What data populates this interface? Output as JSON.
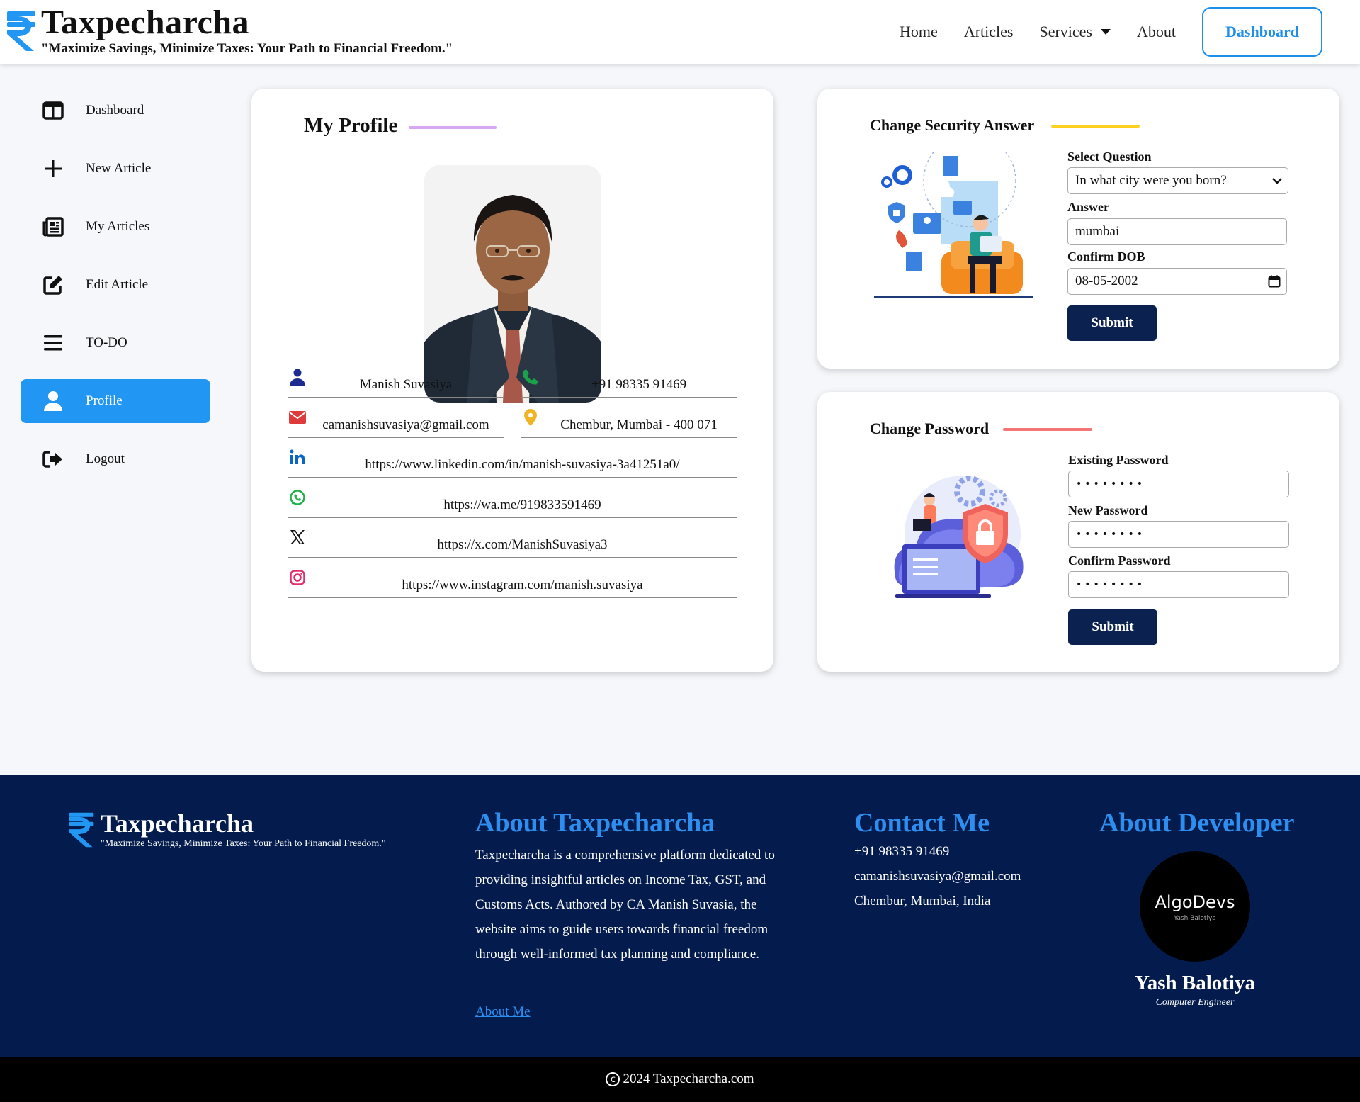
{
  "brand": {
    "name": "Taxpecharcha",
    "tagline": "\"Maximize Savings, Minimize Taxes: Your Path to Financial Freedom.\""
  },
  "nav": {
    "home": "Home",
    "articles": "Articles",
    "services": "Services",
    "about": "About",
    "dashboard": "Dashboard"
  },
  "sidebar": {
    "items": [
      {
        "label": "Dashboard",
        "icon": "dashboard-icon"
      },
      {
        "label": "New Article",
        "icon": "plus-icon"
      },
      {
        "label": "My Articles",
        "icon": "newspaper-icon"
      },
      {
        "label": "Edit Article",
        "icon": "edit-icon"
      },
      {
        "label": "TO-DO",
        "icon": "list-icon"
      },
      {
        "label": "Profile",
        "icon": "user-icon"
      },
      {
        "label": "Logout",
        "icon": "logout-icon"
      }
    ],
    "active_index": 5,
    "active_color": "#2196f3"
  },
  "profile": {
    "title": "My Profile",
    "name": "Manish Suvasiya",
    "phone": "+91 98335 91469",
    "email": "camanishsuvasiya@gmail.com",
    "location": "Chembur, Mumbai - 400 071",
    "linkedin": "https://www.linkedin.com/in/manish-suvasiya-3a41251a0/",
    "whatsapp": "https://wa.me/919833591469",
    "x": "https://x.com/ManishSuvasiya3",
    "instagram": "https://www.instagram.com/manish.suvasiya"
  },
  "security": {
    "title": "Change Security Answer",
    "question_label": "Select Question",
    "question_value": "In what city were you born?",
    "answer_label": "Answer",
    "answer_value": "mumbai",
    "dob_label": "Confirm DOB",
    "dob_value": "08-05-2002",
    "submit": "Submit"
  },
  "password": {
    "title": "Change Password",
    "existing_label": "Existing Password",
    "existing_value": "••••••••",
    "new_label": "New Password",
    "new_value": "••••••••",
    "confirm_label": "Confirm Password",
    "confirm_value": "••••••••",
    "submit": "Submit"
  },
  "footer": {
    "brand_name": "Taxpecharcha",
    "brand_tagline": "\"Maximize Savings, Minimize Taxes: Your Path to Financial Freedom.\"",
    "about_heading": "About Taxpecharcha",
    "about_text": "Taxpecharcha is a comprehensive platform dedicated to providing insightful articles on Income Tax, GST, and Customs Acts. Authored by CA Manish Suvasia, the website aims to guide users towards financial freedom through well-informed tax planning and compliance.",
    "about_link": "About Me",
    "contact_heading": "Contact Me",
    "contact_phone": "+91 98335 91469",
    "contact_email": "camanishsuvasiya@gmail.com",
    "contact_address": "Chembur, Mumbai, India",
    "developer_heading": "About Developer",
    "logo_name": "AlgoDevs",
    "logo_sub": "Yash Balotiya",
    "developer_name": "Yash Balotiya",
    "developer_role": "Computer Engineer"
  },
  "copyright": "2024 Taxpecharcha.com",
  "colors": {
    "brand_blue": "#2196f3",
    "navy": "#041c4d",
    "button_navy": "#0b2150",
    "profile_accent": "#d9a7f2",
    "security_accent": "#ffd21f",
    "password_accent": "#f47575"
  }
}
